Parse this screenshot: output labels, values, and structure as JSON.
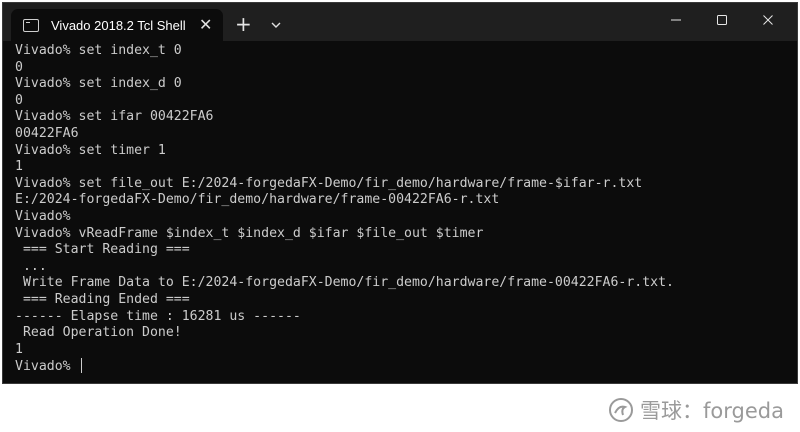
{
  "window": {
    "tab_title": "Vivado 2018.2 Tcl Shell - ("
  },
  "terminal": {
    "lines": [
      "Vivado% set index_t 0",
      "0",
      "Vivado% set index_d 0",
      "0",
      "Vivado% set ifar 00422FA6",
      "00422FA6",
      "Vivado% set timer 1",
      "1",
      "Vivado% set file_out E:/2024-forgedaFX-Demo/fir_demo/hardware/frame-$ifar-r.txt",
      "E:/2024-forgedaFX-Demo/fir_demo/hardware/frame-00422FA6-r.txt",
      "Vivado%",
      "Vivado% vReadFrame $index_t $index_d $ifar $file_out $timer",
      " === Start Reading ===",
      " ...",
      " Write Frame Data to E:/2024-forgedaFX-Demo/fir_demo/hardware/frame-00422FA6-r.txt.",
      " === Reading Ended ===",
      "------ Elapse time : 16281 us ------",
      " Read Operation Done!",
      "1"
    ],
    "prompt": "Vivado% "
  },
  "watermark": {
    "text": "雪球：forgeda"
  }
}
